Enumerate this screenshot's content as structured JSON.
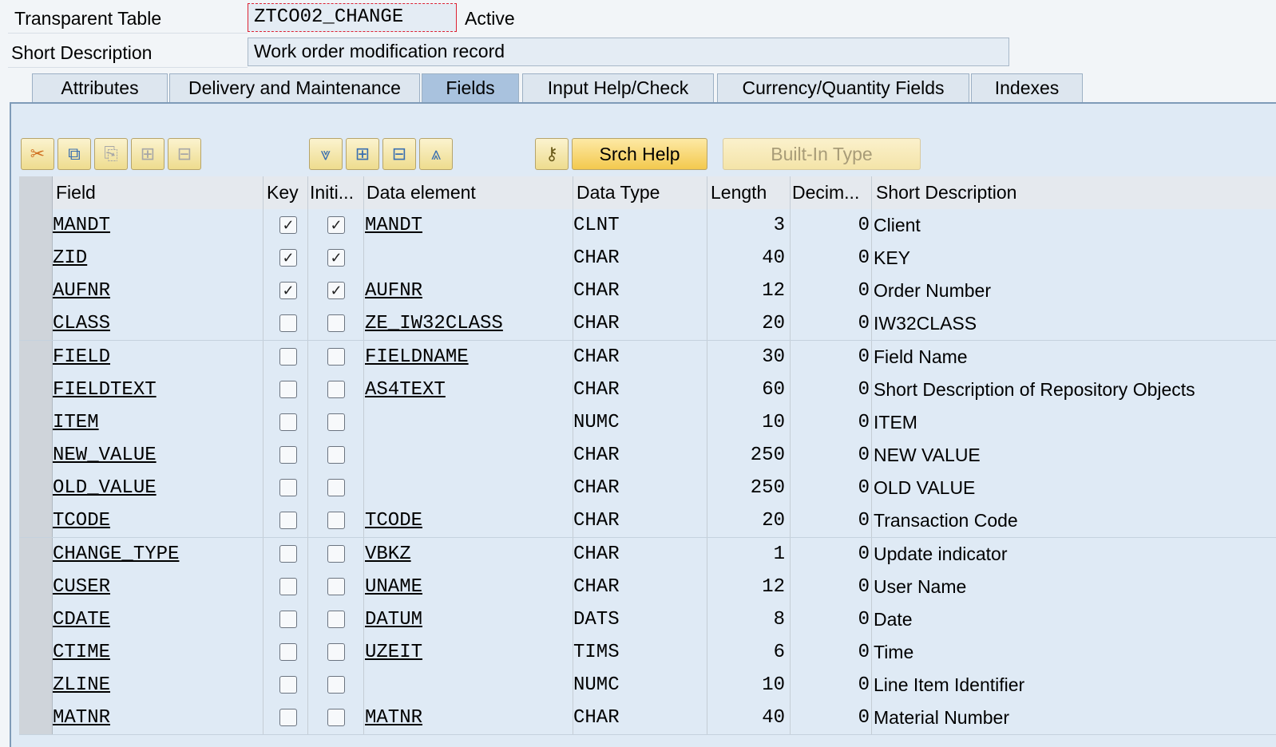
{
  "header": {
    "table_type_label": "Transparent Table",
    "table_name": "ZTCO02_CHANGE",
    "status": "Active",
    "short_desc_label": "Short Description",
    "short_desc_value": "Work order modification record"
  },
  "tabs": [
    {
      "label": "Attributes",
      "active": false
    },
    {
      "label": "Delivery and Maintenance",
      "active": false
    },
    {
      "label": "Fields",
      "active": true
    },
    {
      "label": "Input Help/Check",
      "active": false
    },
    {
      "label": "Currency/Quantity Fields",
      "active": false
    },
    {
      "label": "Indexes",
      "active": false
    }
  ],
  "toolbar": {
    "srch_help": "Srch Help",
    "builtin_type": "Built-In Type",
    "icons": [
      "cut-icon",
      "copy-icon",
      "paste-icon",
      "insert-row-icon",
      "delete-row-icon",
      "filter-down-icon",
      "expand-icon",
      "collapse-icon",
      "filter-up-icon",
      "key-icon"
    ]
  },
  "table": {
    "columns": [
      "Field",
      "Key",
      "Initi...",
      "Data element",
      "Data Type",
      "Length",
      "Decim...",
      "Short Description"
    ],
    "rows": [
      {
        "field": "MANDT",
        "key": true,
        "init": true,
        "elem": "MANDT",
        "type": "CLNT",
        "len": "3",
        "dec": "0",
        "desc": "Client"
      },
      {
        "field": "ZID",
        "key": true,
        "init": true,
        "elem": "",
        "type": "CHAR",
        "len": "40",
        "dec": "0",
        "desc": "KEY"
      },
      {
        "field": "AUFNR",
        "key": true,
        "init": true,
        "elem": "AUFNR",
        "type": "CHAR",
        "len": "12",
        "dec": "0",
        "desc": "Order Number"
      },
      {
        "field": "CLASS",
        "key": false,
        "init": false,
        "elem": "ZE_IW32CLASS",
        "type": "CHAR",
        "len": "20",
        "dec": "0",
        "desc": "IW32CLASS"
      },
      {
        "field": "FIELD",
        "key": false,
        "init": false,
        "elem": "FIELDNAME",
        "type": "CHAR",
        "len": "30",
        "dec": "0",
        "desc": "Field Name"
      },
      {
        "field": "FIELDTEXT",
        "key": false,
        "init": false,
        "elem": "AS4TEXT",
        "type": "CHAR",
        "len": "60",
        "dec": "0",
        "desc": "Short Description of Repository Objects"
      },
      {
        "field": "ITEM",
        "key": false,
        "init": false,
        "elem": "",
        "type": "NUMC",
        "len": "10",
        "dec": "0",
        "desc": "ITEM"
      },
      {
        "field": "NEW_VALUE",
        "key": false,
        "init": false,
        "elem": "",
        "type": "CHAR",
        "len": "250",
        "dec": "0",
        "desc": "NEW VALUE"
      },
      {
        "field": "OLD_VALUE",
        "key": false,
        "init": false,
        "elem": "",
        "type": "CHAR",
        "len": "250",
        "dec": "0",
        "desc": "OLD VALUE"
      },
      {
        "field": "TCODE",
        "key": false,
        "init": false,
        "elem": "TCODE",
        "type": "CHAR",
        "len": "20",
        "dec": "0",
        "desc": "Transaction Code"
      },
      {
        "field": "CHANGE_TYPE",
        "key": false,
        "init": false,
        "elem": "VBKZ",
        "type": "CHAR",
        "len": "1",
        "dec": "0",
        "desc": "Update indicator"
      },
      {
        "field": "CUSER",
        "key": false,
        "init": false,
        "elem": "UNAME",
        "type": "CHAR",
        "len": "12",
        "dec": "0",
        "desc": "User Name"
      },
      {
        "field": "CDATE",
        "key": false,
        "init": false,
        "elem": "DATUM",
        "type": "DATS",
        "len": "8",
        "dec": "0",
        "desc": "Date"
      },
      {
        "field": "CTIME",
        "key": false,
        "init": false,
        "elem": "UZEIT",
        "type": "TIMS",
        "len": "6",
        "dec": "0",
        "desc": "Time"
      },
      {
        "field": "ZLINE",
        "key": false,
        "init": false,
        "elem": "",
        "type": "NUMC",
        "len": "10",
        "dec": "0",
        "desc": "Line Item Identifier"
      },
      {
        "field": "MATNR",
        "key": false,
        "init": false,
        "elem": "MATNR",
        "type": "CHAR",
        "len": "40",
        "dec": "0",
        "desc": "Material Number"
      }
    ]
  }
}
